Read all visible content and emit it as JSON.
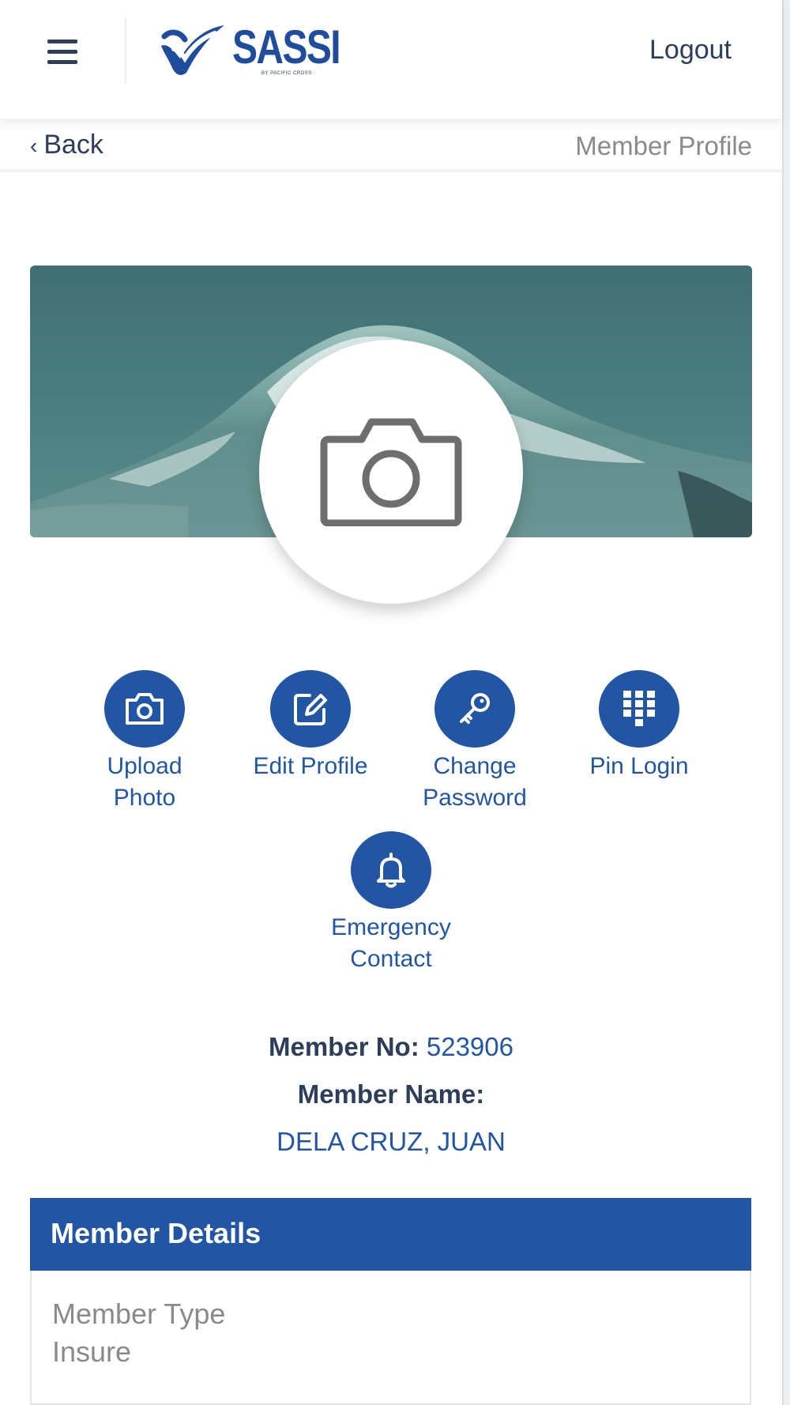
{
  "header": {
    "logo_text": "SASSI",
    "logo_subtext": "BY PACIFIC CROSS",
    "logout_label": "Logout"
  },
  "subheader": {
    "back_label": "Back",
    "title": "Member Profile"
  },
  "actions": [
    {
      "label_line1": "Upload",
      "label_line2": "Photo",
      "icon": "camera-icon"
    },
    {
      "label_line1": "Edit Profile",
      "label_line2": "",
      "icon": "edit-icon"
    },
    {
      "label_line1": "Change",
      "label_line2": "Password",
      "icon": "key-icon"
    },
    {
      "label_line1": "Pin Login",
      "label_line2": "",
      "icon": "keypad-icon"
    },
    {
      "label_line1": "Emergency",
      "label_line2": "Contact",
      "icon": "bell-icon"
    }
  ],
  "member": {
    "number_label": "Member No:",
    "number_value": "523906",
    "name_label": "Member Name:",
    "name_value": "DELA CRUZ, JUAN"
  },
  "details": {
    "heading": "Member Details",
    "fields": [
      {
        "label": "Member Type",
        "value": "Insure"
      }
    ]
  },
  "colors": {
    "brand": "#2255a4",
    "text_dark": "#2c3e5a",
    "muted": "#8a8a8a",
    "banner": "#4d7f81"
  }
}
